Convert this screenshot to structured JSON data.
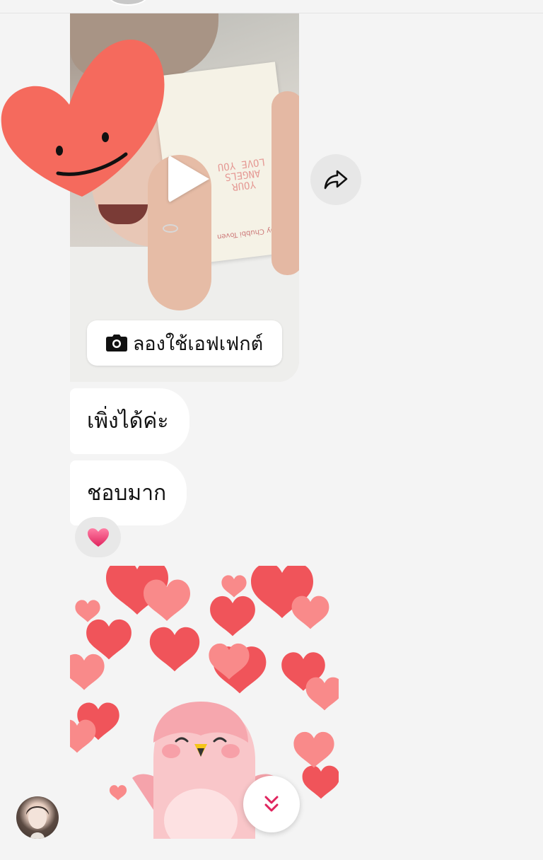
{
  "video_message": {
    "effect_button_label": "ลองใช้เอฟเฟกต์",
    "play_icon": "play-icon",
    "camera_icon": "camera-icon",
    "share_icon": "share-arrow-icon",
    "box_text": "YOUR ANGELS LOVE YOU",
    "box_subtext": "by Chubbi Toven"
  },
  "messages": [
    {
      "text": "เพิ่งได้ค่ะ"
    },
    {
      "text": "ชอบมาก"
    }
  ],
  "reaction": {
    "emoji": "❤️",
    "icon": "heart-icon"
  },
  "sticker": {
    "icon": "pink-bird-hearts-sticker"
  },
  "scroll_button": {
    "icon": "double-chevron-down-icon"
  },
  "colors": {
    "background": "#f4f4f4",
    "bubble": "#ffffff",
    "heart": "#f56a5d",
    "accent": "#e0245e"
  }
}
